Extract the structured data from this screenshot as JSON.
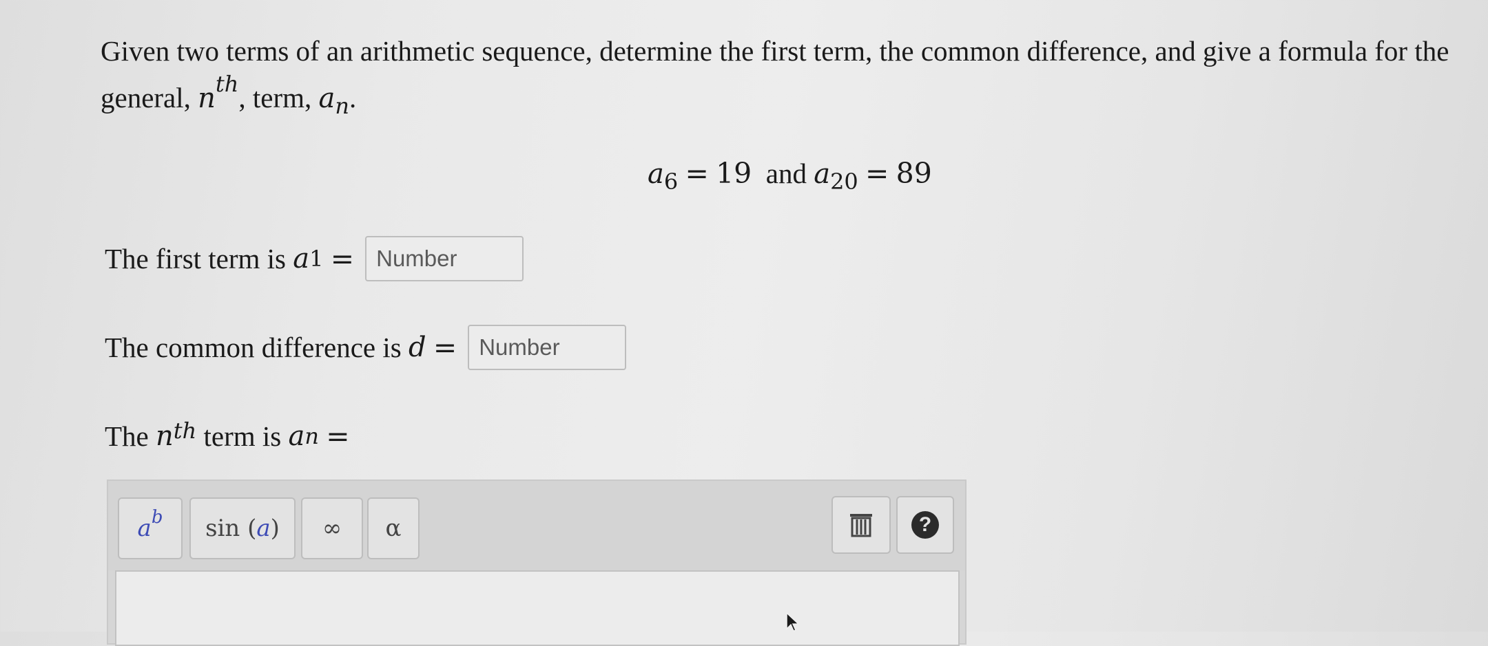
{
  "question": {
    "intro": "Given two terms of an arithmetic sequence, determine the first term, the common difference, and give a formula for the general,",
    "n_var": "n",
    "th_sup": "th",
    "mid": ", term,",
    "a_var": "a",
    "n_sub": "n",
    "end": "."
  },
  "given": {
    "a1_var": "a",
    "a1_sub": "6",
    "a1_eq": "=",
    "a1_val": "19",
    "and": "and",
    "a2_var": "a",
    "a2_sub": "20",
    "a2_eq": "=",
    "a2_val": "89"
  },
  "first_term": {
    "label": "The first term is",
    "var": "a",
    "sub": "1",
    "eq": "=",
    "placeholder": "Number",
    "value": ""
  },
  "common_diff": {
    "label": "The common difference is",
    "var": "d",
    "eq": "=",
    "placeholder": "Number",
    "value": ""
  },
  "nth_term": {
    "the": "The",
    "n_var": "n",
    "th_sup": "th",
    "label": "term is",
    "var": "a",
    "sub": "n",
    "eq": "="
  },
  "toolbar": {
    "power_base": "a",
    "power_exp": "b",
    "sin_label": "sin",
    "sin_open": "(",
    "sin_arg": "a",
    "sin_close": ")",
    "infinity": "∞",
    "alpha": "α",
    "help": "?"
  },
  "icons": {
    "trash": "trash-icon",
    "help": "question-circle-icon"
  },
  "colors": {
    "accent": "#3d4bb5",
    "background": "#e6e6e6"
  }
}
